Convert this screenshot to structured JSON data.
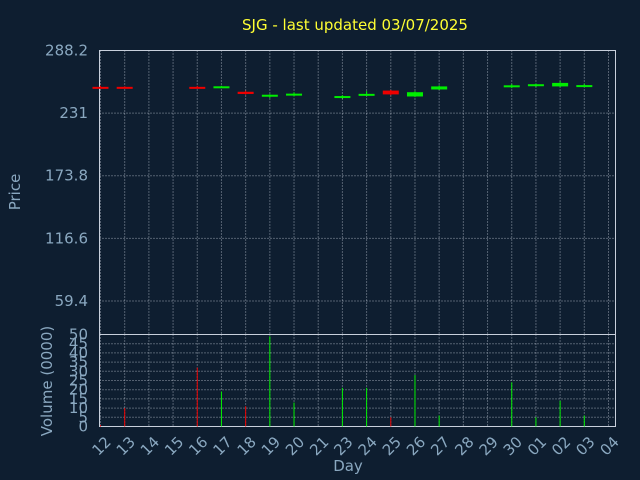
{
  "chart_data": {
    "type": "candlestick",
    "title": "SJG - last updated 03/07/2025",
    "colors": {
      "up": "#00ee00",
      "down": "#ee0000",
      "background": "#0e1e30",
      "text": "#8aa8c0",
      "title": "#ffff33"
    },
    "grid": true,
    "price_panel": {
      "ylabel": "Price",
      "ylim": [
        28.8,
        288.2
      ],
      "yticks": [
        "288.2",
        "231",
        "173.8",
        "116.6",
        "59.4"
      ],
      "ytick_values": [
        288.2,
        231,
        173.8,
        116.6,
        59.4
      ]
    },
    "volume_panel": {
      "ylabel": "Volume (0000)",
      "ylim": [
        0,
        50
      ],
      "yticks": [
        "50",
        "45",
        "40",
        "35",
        "30",
        "25",
        "20",
        "15",
        "10",
        "5",
        "0"
      ],
      "ytick_values": [
        50,
        45,
        40,
        35,
        30,
        25,
        20,
        15,
        10,
        5,
        0
      ]
    },
    "xlabel": "Day",
    "categories": [
      "12",
      "13",
      "14",
      "15",
      "16",
      "17",
      "18",
      "19",
      "20",
      "21",
      "23",
      "24",
      "25",
      "26",
      "27",
      "28",
      "29",
      "30",
      "01",
      "02",
      "03",
      "04"
    ],
    "candles": [
      {
        "day": "12",
        "open": 255,
        "high": 256,
        "low": 254,
        "close": 254.5,
        "volume": 0.8
      },
      {
        "day": "13",
        "open": 255,
        "high": 255.5,
        "low": 254,
        "close": 254.5,
        "volume": 10
      },
      {
        "day": "16",
        "open": 255,
        "high": 256,
        "low": 254,
        "close": 254.5,
        "volume": 32
      },
      {
        "day": "17",
        "open": 255,
        "high": 256,
        "low": 254.5,
        "close": 255.5,
        "volume": 19
      },
      {
        "day": "18",
        "open": 250.5,
        "high": 251.5,
        "low": 247.8,
        "close": 248.5,
        "volume": 11
      },
      {
        "day": "19",
        "open": 246.2,
        "high": 248.3,
        "low": 244.8,
        "close": 247.8,
        "volume": 49
      },
      {
        "day": "20",
        "open": 247.3,
        "high": 250.1,
        "low": 246.2,
        "close": 248.8,
        "volume": 13
      },
      {
        "day": "23",
        "open": 245.3,
        "high": 247.5,
        "low": 244.3,
        "close": 246.6,
        "volume": 21
      },
      {
        "day": "24",
        "open": 247.1,
        "high": 251.1,
        "low": 246.6,
        "close": 248.6,
        "volume": 21
      },
      {
        "day": "25",
        "open": 251.6,
        "high": 252.2,
        "low": 247.3,
        "close": 248.1,
        "volume": 5
      },
      {
        "day": "26",
        "open": 246.2,
        "high": 251.1,
        "low": 245.6,
        "close": 250.1,
        "volume": 28
      },
      {
        "day": "27",
        "open": 252.6,
        "high": 256.4,
        "low": 252.1,
        "close": 255.4,
        "volume": 6
      },
      {
        "day": "30",
        "open": 255.1,
        "high": 257.6,
        "low": 253.8,
        "close": 256.4,
        "volume": 24
      },
      {
        "day": "01",
        "open": 256.1,
        "high": 258.1,
        "low": 255.1,
        "close": 257.4,
        "volume": 5
      },
      {
        "day": "02",
        "open": 255.4,
        "high": 260.1,
        "low": 254.8,
        "close": 258.6,
        "volume": 14
      },
      {
        "day": "03",
        "open": 255.8,
        "high": 257.9,
        "low": 254.8,
        "close": 256.6,
        "volume": 6
      }
    ]
  }
}
